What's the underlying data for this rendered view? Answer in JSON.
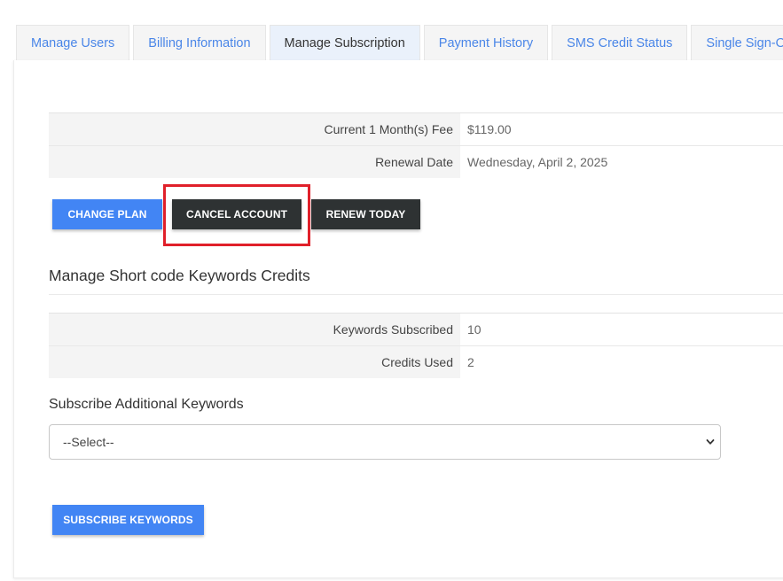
{
  "tabs": [
    {
      "label": "Manage Users",
      "active": false
    },
    {
      "label": "Billing Information",
      "active": false
    },
    {
      "label": "Manage Subscription",
      "active": true
    },
    {
      "label": "Payment History",
      "active": false
    },
    {
      "label": "SMS Credit Status",
      "active": false
    },
    {
      "label": "Single Sign-On",
      "active": false
    }
  ],
  "subscription": {
    "rows": [
      {
        "label": "Current 1 Month(s) Fee",
        "value": "$119.00"
      },
      {
        "label": "Renewal Date",
        "value": "Wednesday, April 2, 2025"
      }
    ]
  },
  "buttons": {
    "change_plan": "CHANGE PLAN",
    "cancel_account": "CANCEL ACCOUNT",
    "renew_today": "RENEW TODAY",
    "subscribe_keywords": "SUBSCRIBE KEYWORDS"
  },
  "keywords": {
    "title": "Manage Short code Keywords Credits",
    "rows": [
      {
        "label": "Keywords Subscribed",
        "value": "10"
      },
      {
        "label": "Credits Used",
        "value": "2"
      }
    ],
    "additional_label": "Subscribe Additional Keywords",
    "select_value": "--Select--"
  },
  "colors": {
    "accent_blue": "#4285f4",
    "dark_button": "#2e3233",
    "highlight_red": "#e0202a",
    "tab_link": "#4a86e8"
  },
  "icons": {
    "select_arrow": "chevron-down-icon"
  }
}
